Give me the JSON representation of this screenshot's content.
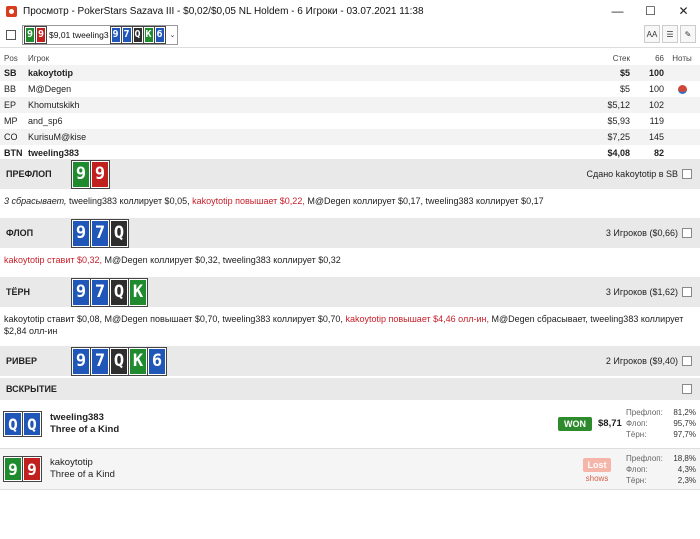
{
  "window": {
    "title": "Просмотр - PokerStars Sazava III - $0,02/$0,05 NL Holdem - 6 Игроки - 03.07.2021 11:38",
    "controls": [
      "—",
      "☐",
      "✕"
    ]
  },
  "toolbar": {
    "hand_selector": {
      "amount_text": "$9,01 tweeling3",
      "hero_cards": [
        {
          "rank": "9",
          "suit": "green"
        },
        {
          "rank": "9",
          "suit": "red"
        }
      ],
      "board_cards": [
        {
          "rank": "9",
          "suit": "blue"
        },
        {
          "rank": "7",
          "suit": "blue"
        },
        {
          "rank": "Q",
          "suit": "black"
        },
        {
          "rank": "K",
          "suit": "green"
        },
        {
          "rank": "6",
          "suit": "blue"
        }
      ],
      "arrow": "⌄"
    },
    "font_btn": "AA",
    "list_btn": "☰",
    "edit_btn": "✎"
  },
  "players_table": {
    "headers": {
      "pos": "Pos",
      "player": "Игрок",
      "stack": "Стек",
      "bb": "66",
      "notes": "Ноты"
    },
    "rows": [
      {
        "pos": "SB",
        "name": "kakoytotip",
        "stack": "$5",
        "bb": "100",
        "bold": true
      },
      {
        "pos": "BB",
        "name": "M@Degen",
        "stack": "$5",
        "bb": "100",
        "bold": false,
        "note": true
      },
      {
        "pos": "EP",
        "name": "Khomutskikh",
        "stack": "$5,12",
        "bb": "102",
        "bold": false
      },
      {
        "pos": "MP",
        "name": "and_sp6",
        "stack": "$5,93",
        "bb": "119",
        "bold": false
      },
      {
        "pos": "CO",
        "name": "KurisuM@kise",
        "stack": "$7,25",
        "bb": "145",
        "bold": false
      },
      {
        "pos": "BTN",
        "name": "tweeling383",
        "stack": "$4,08",
        "bb": "82",
        "bold": true
      }
    ]
  },
  "streets": {
    "preflop": {
      "name": "ПРЕФЛОП",
      "cards": [
        {
          "rank": "9",
          "suit": "green"
        },
        {
          "rank": "9",
          "suit": "red"
        }
      ],
      "info": "Сдано kakoytotip в SB",
      "actions": [
        {
          "text": "3 сбрасывает, ",
          "style": "ital"
        },
        {
          "text": "tweeling383 коллирует $0,05, ",
          "style": ""
        },
        {
          "text": "kakoytotip повышает $0,22, ",
          "style": "red"
        },
        {
          "text": "M@Degen коллирует $0,17, tweeling383 коллирует $0,17",
          "style": ""
        }
      ]
    },
    "flop": {
      "name": "ФЛОП",
      "cards": [
        {
          "rank": "9",
          "suit": "blue"
        },
        {
          "rank": "7",
          "suit": "blue"
        },
        {
          "rank": "Q",
          "suit": "black"
        }
      ],
      "info": "3 Игроков ($0,66)",
      "actions": [
        {
          "text": "kakoytotip ставит $0,32, ",
          "style": "red"
        },
        {
          "text": "M@Degen коллирует $0,32, tweeling383 коллирует $0,32",
          "style": ""
        }
      ]
    },
    "turn": {
      "name": "ТЁРН",
      "cards": [
        {
          "rank": "9",
          "suit": "blue"
        },
        {
          "rank": "7",
          "suit": "blue"
        },
        {
          "rank": "Q",
          "suit": "black"
        },
        {
          "rank": "K",
          "suit": "green"
        }
      ],
      "info": "3 Игроков ($1,62)",
      "actions": [
        {
          "text": "kakoytotip ставит $0,08, M@Degen повышает $0,70, tweeling383 коллирует $0,70, ",
          "style": ""
        },
        {
          "text": "kakoytotip повышает $4,46 олл-ин, ",
          "style": "red"
        },
        {
          "text": "M@Degen сбрасывает, tweeling383 коллирует $2,84 олл-ин",
          "style": ""
        }
      ]
    },
    "river": {
      "name": "РИВЕР",
      "cards": [
        {
          "rank": "9",
          "suit": "blue"
        },
        {
          "rank": "7",
          "suit": "blue"
        },
        {
          "rank": "Q",
          "suit": "black"
        },
        {
          "rank": "K",
          "suit": "green"
        },
        {
          "rank": "6",
          "suit": "blue"
        }
      ],
      "info": "2 Игроков ($9,40)"
    }
  },
  "showdown": {
    "name": "ВСКРЫТИЕ",
    "players": [
      {
        "name": "tweeling383",
        "hand": "Three of a Kind",
        "cards": [
          {
            "rank": "Q",
            "suit": "blue"
          },
          {
            "rank": "Q",
            "suit": "blue"
          }
        ],
        "result": "WON",
        "amount": "$8,71",
        "equity": [
          {
            "label": "Префлоп:",
            "value": "81,2%"
          },
          {
            "label": "Флоп:",
            "value": "95,7%"
          },
          {
            "label": "Тёрн:",
            "value": "97,7%"
          }
        ]
      },
      {
        "name": "kakoytotip",
        "hand": "Three of a Kind",
        "cards": [
          {
            "rank": "9",
            "suit": "green"
          },
          {
            "rank": "9",
            "suit": "red"
          }
        ],
        "result": "Lost",
        "sub": "shows",
        "equity": [
          {
            "label": "Префлоп:",
            "value": "18,8%"
          },
          {
            "label": "Флоп:",
            "value": "4,3%"
          },
          {
            "label": "Тёрн:",
            "value": "2,3%"
          }
        ]
      }
    ]
  }
}
